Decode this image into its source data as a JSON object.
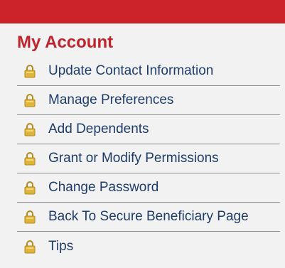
{
  "header": {
    "title": "My Account"
  },
  "menu": {
    "items": [
      {
        "label": "Update Contact Information",
        "icon": "lock-icon"
      },
      {
        "label": "Manage Preferences",
        "icon": "lock-icon"
      },
      {
        "label": "Add Dependents",
        "icon": "lock-icon"
      },
      {
        "label": "Grant or Modify Permissions",
        "icon": "lock-icon"
      },
      {
        "label": "Change Password",
        "icon": "lock-icon"
      },
      {
        "label": "Back To Secure Beneficiary Page",
        "icon": "lock-icon"
      },
      {
        "label": "Tips",
        "icon": "lock-icon"
      }
    ]
  },
  "colors": {
    "brand_red": "#cc2229",
    "title_red": "#c0232b",
    "link_blue": "#1e3d6b",
    "panel_bg": "#f2f2f2",
    "lock_gold": "#e0b43a"
  }
}
